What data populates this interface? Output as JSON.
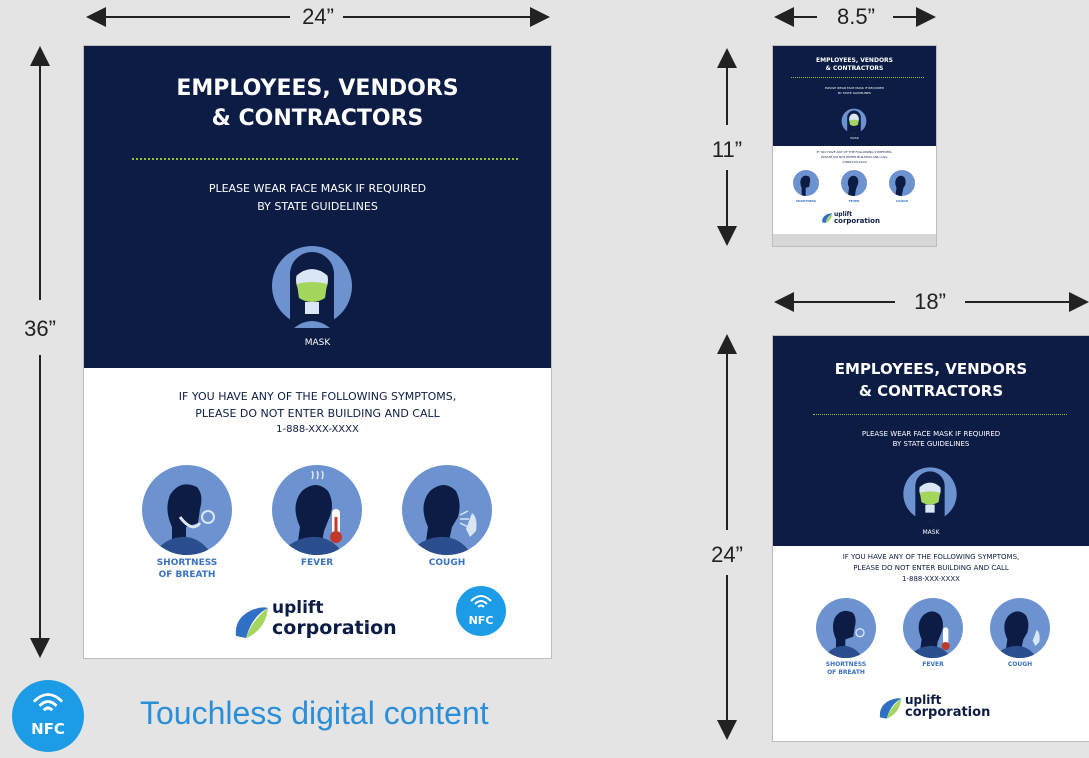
{
  "dimensions": {
    "large_width": "24”",
    "large_height": "36”",
    "small_width": "8.5”",
    "small_height": "11”",
    "medium_width": "18”",
    "medium_height": "24”"
  },
  "poster": {
    "title_line1": "EMPLOYEES, VENDORS",
    "title_line2": "& CONTRACTORS",
    "mask_line1": "PLEASE WEAR FACE MASK IF REQUIRED",
    "mask_line2": "BY STATE GUIDELINES",
    "mask_label": "MASK",
    "symptoms_line1": "IF YOU HAVE ANY OF THE FOLLOWING SYMPTOMS,",
    "symptoms_line2": "PLEASE DO NOT ENTER BUILDING AND CALL",
    "phone": "1-888-XXX-XXXX",
    "symptoms": [
      {
        "label_line1": "SHORTNESS",
        "label_line2": "OF BREATH",
        "icon": "shortness-of-breath-icon"
      },
      {
        "label_line1": "FEVER",
        "label_line2": "",
        "icon": "fever-icon"
      },
      {
        "label_line1": "COUGH",
        "label_line2": "",
        "icon": "cough-icon"
      }
    ],
    "brand_line1": "uplift",
    "brand_line2": "corporation",
    "nfc_badge": "NFC"
  },
  "footer": {
    "nfc_label": "NFC",
    "caption": "Touchless digital content"
  },
  "colors": {
    "navy": "#0c1c45",
    "accent_blue": "#3a72c2",
    "icon_blue": "#6c93cf",
    "mask_green": "#a4d65e",
    "nfc_blue": "#1c9be6",
    "caption_blue": "#2a8fd8"
  }
}
